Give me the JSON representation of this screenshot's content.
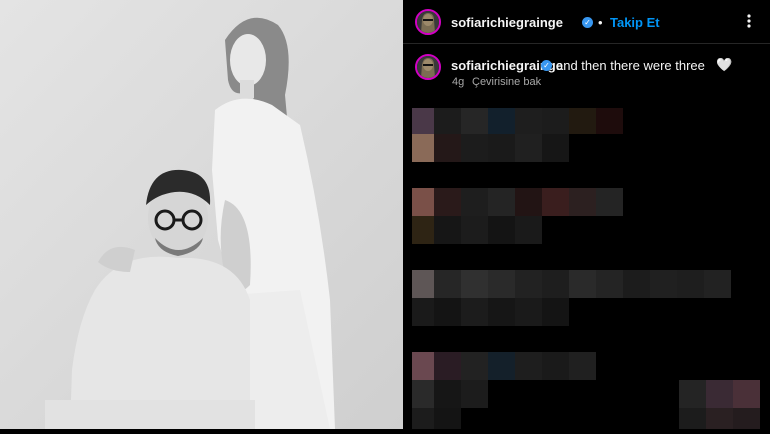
{
  "post": {
    "image_description_icon": "photo-couple-icon"
  },
  "header": {
    "username": "sofiarichiegrainge",
    "verified_icon": "verified-badge-icon",
    "separator": "•",
    "follow_label": "Takip Et",
    "more_icon": "more-options-icon"
  },
  "caption": {
    "username": "sofiarichiegrainge",
    "text": "and then there were three",
    "emoji": "🤍",
    "time": "4g",
    "see_translation": "Çevirisine bak"
  },
  "colors": {
    "background": "#000000",
    "link": "#0095f6",
    "verified": "#3897f0",
    "story_ring": "#d300c5",
    "muted_text": "#a8a8a8"
  }
}
